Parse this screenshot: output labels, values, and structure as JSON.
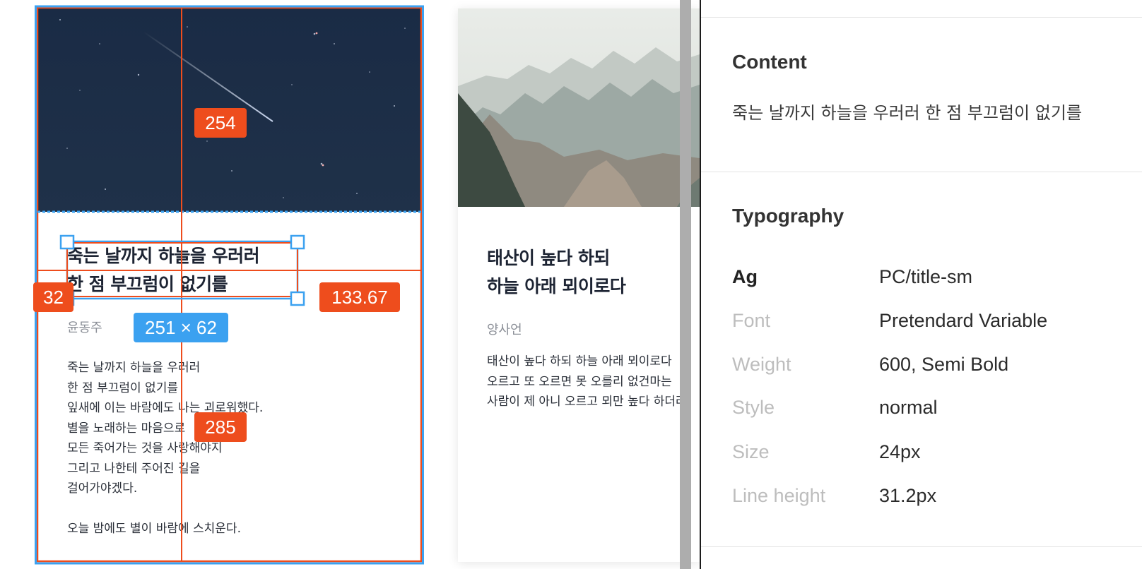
{
  "cards": [
    {
      "title": "죽는 날까지 하늘을 우러러\n한 점 부끄럼이 없기를",
      "author": "윤동주",
      "body": "죽는 날까지 하늘을 우러러\n한 점 부끄럼이 없기를\n잎새에 이는 바람에도 나는 괴로워했다.\n별을 노래하는 마음으로\n모든 죽어가는 것을 사랑해야지\n그리고 나한테 주어진 길을\n걸어가야겠다.\n\n오늘 밤에도 별이 바람에 스치운다.",
      "image": "night-sky"
    },
    {
      "title": "태산이 높다 하되\n하늘 아래 뫼이로다",
      "author": "양사언",
      "body": "태산이 높다 하되 하늘 아래 뫼이로다\n오르고 또 오르면 못 오를리 없건마는\n사람이 제 아니 오르고 뫼만 높다 하더라",
      "image": "mountains"
    }
  ],
  "measurements": {
    "top": "254",
    "left": "32",
    "right": "133.67",
    "bottom": "285",
    "size": "251 × 62"
  },
  "inspector": {
    "content": {
      "heading": "Content",
      "text": "죽는 날까지 하늘을 우러러 한 점 부끄럼이 없기를"
    },
    "typography": {
      "heading": "Typography",
      "rows": [
        {
          "label": "Ag",
          "value": "PC/title-sm"
        },
        {
          "label": "Font",
          "value": "Pretendard Variable"
        },
        {
          "label": "Weight",
          "value": "600, Semi Bold"
        },
        {
          "label": "Style",
          "value": "normal"
        },
        {
          "label": "Size",
          "value": "24px"
        },
        {
          "label": "Line height",
          "value": "31.2px"
        }
      ]
    }
  },
  "colors": {
    "measure_orange": "#ee4d1d",
    "selection_blue": "#3ba1f0",
    "title_text": "#1d2433"
  }
}
